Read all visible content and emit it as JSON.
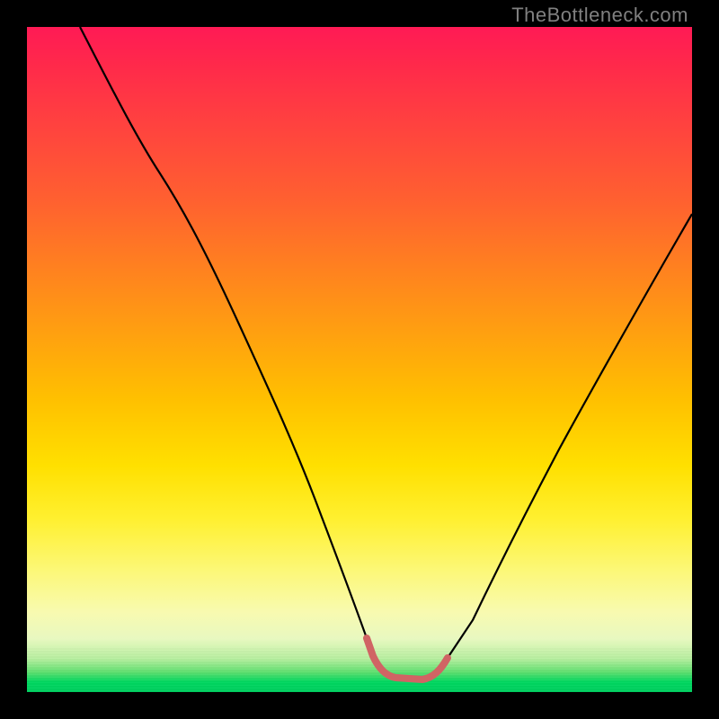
{
  "watermark": "TheBottleneck.com",
  "colors": {
    "background": "#000000",
    "gradient_top": "#ff1a55",
    "gradient_mid_orange": "#ff8020",
    "gradient_yellow": "#ffe000",
    "gradient_pale": "#f8fab0",
    "gradient_green": "#00d860",
    "curve_stroke": "#000000",
    "highlight_stroke": "#d86060",
    "watermark_text": "#808080"
  },
  "chart_data": {
    "type": "line",
    "title": "",
    "xlabel": "",
    "ylabel": "",
    "xlim": [
      0,
      100
    ],
    "ylim": [
      0,
      100
    ],
    "description": "V-shaped bottleneck curve. Left arm descends steeply from top-left, bottoms out as a short flat segment, then right arm rises more gently. The flat bottom segment is highlighted in a reddish stroke. Percentages are estimated from position within the plot area.",
    "series": [
      {
        "name": "bottleneck-curve",
        "x": [
          8,
          14,
          20,
          26,
          32,
          38,
          44,
          49,
          52,
          55,
          58,
          61,
          63,
          67,
          73,
          80,
          88,
          96,
          100
        ],
        "y": [
          100,
          89,
          78,
          66,
          55,
          43,
          31,
          19,
          10,
          4,
          2,
          2,
          4,
          10,
          22,
          36,
          51,
          66,
          74
        ]
      }
    ],
    "highlight_segment": {
      "name": "optimal-range",
      "x": [
        52,
        55,
        58,
        61,
        63
      ],
      "y": [
        10,
        4,
        2,
        2,
        4
      ]
    }
  }
}
